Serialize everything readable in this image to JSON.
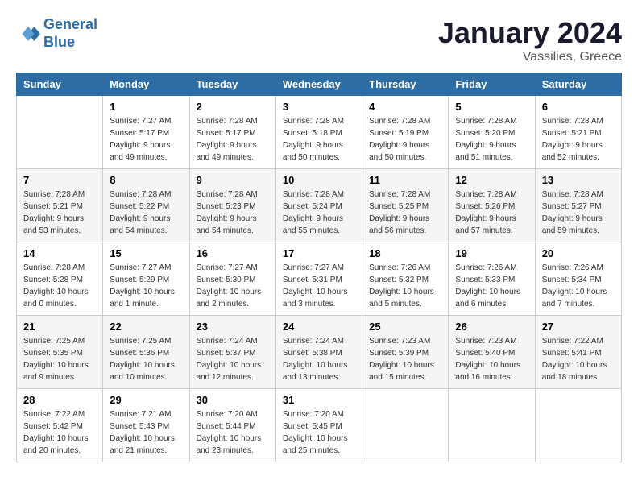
{
  "logo": {
    "line1": "General",
    "line2": "Blue"
  },
  "title": "January 2024",
  "subtitle": "Vassilies, Greece",
  "columns": [
    "Sunday",
    "Monday",
    "Tuesday",
    "Wednesday",
    "Thursday",
    "Friday",
    "Saturday"
  ],
  "weeks": [
    [
      {
        "day": "",
        "sunrise": "",
        "sunset": "",
        "daylight": ""
      },
      {
        "day": "1",
        "sunrise": "Sunrise: 7:27 AM",
        "sunset": "Sunset: 5:17 PM",
        "daylight": "Daylight: 9 hours and 49 minutes."
      },
      {
        "day": "2",
        "sunrise": "Sunrise: 7:28 AM",
        "sunset": "Sunset: 5:17 PM",
        "daylight": "Daylight: 9 hours and 49 minutes."
      },
      {
        "day": "3",
        "sunrise": "Sunrise: 7:28 AM",
        "sunset": "Sunset: 5:18 PM",
        "daylight": "Daylight: 9 hours and 50 minutes."
      },
      {
        "day": "4",
        "sunrise": "Sunrise: 7:28 AM",
        "sunset": "Sunset: 5:19 PM",
        "daylight": "Daylight: 9 hours and 50 minutes."
      },
      {
        "day": "5",
        "sunrise": "Sunrise: 7:28 AM",
        "sunset": "Sunset: 5:20 PM",
        "daylight": "Daylight: 9 hours and 51 minutes."
      },
      {
        "day": "6",
        "sunrise": "Sunrise: 7:28 AM",
        "sunset": "Sunset: 5:21 PM",
        "daylight": "Daylight: 9 hours and 52 minutes."
      }
    ],
    [
      {
        "day": "7",
        "sunrise": "Sunrise: 7:28 AM",
        "sunset": "Sunset: 5:21 PM",
        "daylight": "Daylight: 9 hours and 53 minutes."
      },
      {
        "day": "8",
        "sunrise": "Sunrise: 7:28 AM",
        "sunset": "Sunset: 5:22 PM",
        "daylight": "Daylight: 9 hours and 54 minutes."
      },
      {
        "day": "9",
        "sunrise": "Sunrise: 7:28 AM",
        "sunset": "Sunset: 5:23 PM",
        "daylight": "Daylight: 9 hours and 54 minutes."
      },
      {
        "day": "10",
        "sunrise": "Sunrise: 7:28 AM",
        "sunset": "Sunset: 5:24 PM",
        "daylight": "Daylight: 9 hours and 55 minutes."
      },
      {
        "day": "11",
        "sunrise": "Sunrise: 7:28 AM",
        "sunset": "Sunset: 5:25 PM",
        "daylight": "Daylight: 9 hours and 56 minutes."
      },
      {
        "day": "12",
        "sunrise": "Sunrise: 7:28 AM",
        "sunset": "Sunset: 5:26 PM",
        "daylight": "Daylight: 9 hours and 57 minutes."
      },
      {
        "day": "13",
        "sunrise": "Sunrise: 7:28 AM",
        "sunset": "Sunset: 5:27 PM",
        "daylight": "Daylight: 9 hours and 59 minutes."
      }
    ],
    [
      {
        "day": "14",
        "sunrise": "Sunrise: 7:28 AM",
        "sunset": "Sunset: 5:28 PM",
        "daylight": "Daylight: 10 hours and 0 minutes."
      },
      {
        "day": "15",
        "sunrise": "Sunrise: 7:27 AM",
        "sunset": "Sunset: 5:29 PM",
        "daylight": "Daylight: 10 hours and 1 minute."
      },
      {
        "day": "16",
        "sunrise": "Sunrise: 7:27 AM",
        "sunset": "Sunset: 5:30 PM",
        "daylight": "Daylight: 10 hours and 2 minutes."
      },
      {
        "day": "17",
        "sunrise": "Sunrise: 7:27 AM",
        "sunset": "Sunset: 5:31 PM",
        "daylight": "Daylight: 10 hours and 3 minutes."
      },
      {
        "day": "18",
        "sunrise": "Sunrise: 7:26 AM",
        "sunset": "Sunset: 5:32 PM",
        "daylight": "Daylight: 10 hours and 5 minutes."
      },
      {
        "day": "19",
        "sunrise": "Sunrise: 7:26 AM",
        "sunset": "Sunset: 5:33 PM",
        "daylight": "Daylight: 10 hours and 6 minutes."
      },
      {
        "day": "20",
        "sunrise": "Sunrise: 7:26 AM",
        "sunset": "Sunset: 5:34 PM",
        "daylight": "Daylight: 10 hours and 7 minutes."
      }
    ],
    [
      {
        "day": "21",
        "sunrise": "Sunrise: 7:25 AM",
        "sunset": "Sunset: 5:35 PM",
        "daylight": "Daylight: 10 hours and 9 minutes."
      },
      {
        "day": "22",
        "sunrise": "Sunrise: 7:25 AM",
        "sunset": "Sunset: 5:36 PM",
        "daylight": "Daylight: 10 hours and 10 minutes."
      },
      {
        "day": "23",
        "sunrise": "Sunrise: 7:24 AM",
        "sunset": "Sunset: 5:37 PM",
        "daylight": "Daylight: 10 hours and 12 minutes."
      },
      {
        "day": "24",
        "sunrise": "Sunrise: 7:24 AM",
        "sunset": "Sunset: 5:38 PM",
        "daylight": "Daylight: 10 hours and 13 minutes."
      },
      {
        "day": "25",
        "sunrise": "Sunrise: 7:23 AM",
        "sunset": "Sunset: 5:39 PM",
        "daylight": "Daylight: 10 hours and 15 minutes."
      },
      {
        "day": "26",
        "sunrise": "Sunrise: 7:23 AM",
        "sunset": "Sunset: 5:40 PM",
        "daylight": "Daylight: 10 hours and 16 minutes."
      },
      {
        "day": "27",
        "sunrise": "Sunrise: 7:22 AM",
        "sunset": "Sunset: 5:41 PM",
        "daylight": "Daylight: 10 hours and 18 minutes."
      }
    ],
    [
      {
        "day": "28",
        "sunrise": "Sunrise: 7:22 AM",
        "sunset": "Sunset: 5:42 PM",
        "daylight": "Daylight: 10 hours and 20 minutes."
      },
      {
        "day": "29",
        "sunrise": "Sunrise: 7:21 AM",
        "sunset": "Sunset: 5:43 PM",
        "daylight": "Daylight: 10 hours and 21 minutes."
      },
      {
        "day": "30",
        "sunrise": "Sunrise: 7:20 AM",
        "sunset": "Sunset: 5:44 PM",
        "daylight": "Daylight: 10 hours and 23 minutes."
      },
      {
        "day": "31",
        "sunrise": "Sunrise: 7:20 AM",
        "sunset": "Sunset: 5:45 PM",
        "daylight": "Daylight: 10 hours and 25 minutes."
      },
      {
        "day": "",
        "sunrise": "",
        "sunset": "",
        "daylight": ""
      },
      {
        "day": "",
        "sunrise": "",
        "sunset": "",
        "daylight": ""
      },
      {
        "day": "",
        "sunrise": "",
        "sunset": "",
        "daylight": ""
      }
    ]
  ]
}
